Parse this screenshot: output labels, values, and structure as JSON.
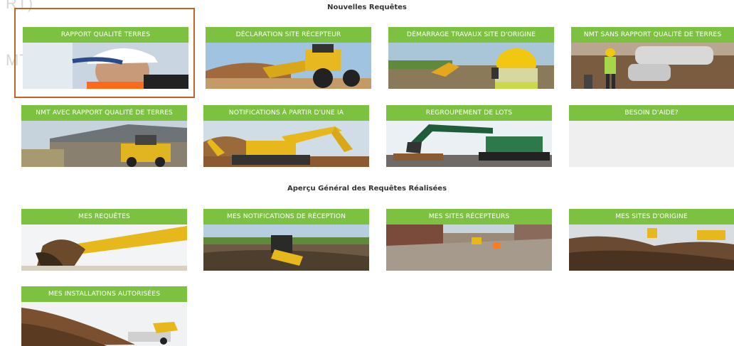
{
  "ghost_text": {
    "line1": "RT)",
    "line2": "MT)"
  },
  "sections": {
    "new_requests": "Nouvelles Requêtes",
    "overview": "Aperçu Général des Requêtes Réalisées"
  },
  "tiles": [
    {
      "label": "RAPPORT QUALITÉ TERRES",
      "image": "worker-hardhat"
    },
    {
      "label": "DÉCLARATION SITE RÉCEPTEUR",
      "image": "wheel-loader"
    },
    {
      "label": "DÉMARRAGE TRAVAUX SITE D'ORIGINE",
      "image": "worker-yellow-helmet"
    },
    {
      "label": "NMT SANS RAPPORT QUALITÉ DE TERRES",
      "image": "pipe-worker"
    },
    {
      "label": "NMT AVEC RAPPORT QUALITÉ DE TERRES",
      "image": "shed-loader"
    },
    {
      "label": "NOTIFICATIONS À PARTIR D'UNE IA",
      "image": "excavator-yellow"
    },
    {
      "label": "REGROUPEMENT DE LOTS",
      "image": "excavator-green"
    },
    {
      "label": "BESOIN D'AIDE?",
      "image": ""
    },
    {
      "label": "MES REQUÊTES",
      "image": "excavator-arm"
    },
    {
      "label": "MES NOTIFICATIONS DE RÉCEPTION",
      "image": "excavator-field"
    },
    {
      "label": "MES SITES RÉCEPTEURS",
      "image": "street-works"
    },
    {
      "label": "MES SITES D'ORIGINE",
      "image": "soil-pile"
    },
    {
      "label": "MES INSTALLATIONS AUTORISÉES",
      "image": "soil-mound-loader"
    }
  ],
  "colors": {
    "tile_green": "#7cc240",
    "selection_border": "#c0632a"
  }
}
